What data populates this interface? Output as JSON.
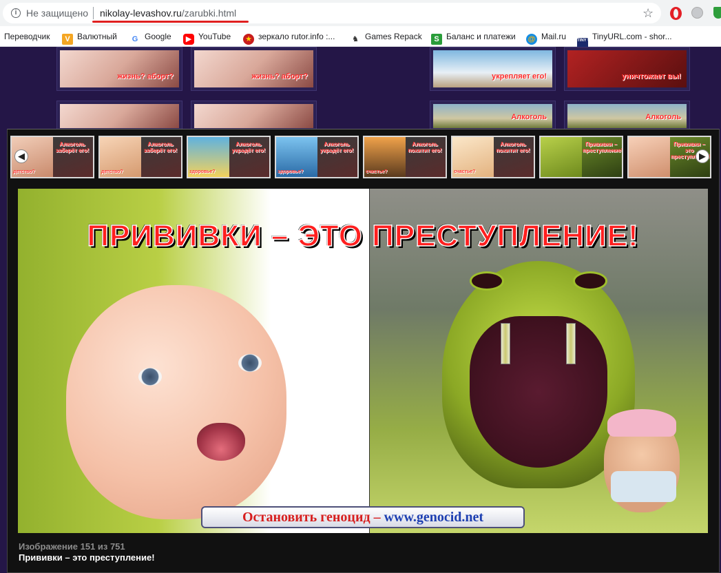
{
  "browser": {
    "security_label": "Не защищено",
    "url_domain": "nikolay-levashov.ru",
    "url_path": "/zarubki.html"
  },
  "bookmarks": [
    {
      "label": "Переводчик",
      "icon": "none"
    },
    {
      "label": "Валютный",
      "icon": "currency-icon"
    },
    {
      "label": "Google",
      "icon": "google-icon"
    },
    {
      "label": "YouTube",
      "icon": "youtube-icon"
    },
    {
      "label": "зеркало rutor.info :...",
      "icon": "rutor-icon"
    },
    {
      "label": "Games Repack",
      "icon": "repack-icon"
    },
    {
      "label": "Баланс и платежи",
      "icon": "skype-icon"
    },
    {
      "label": "Mail.ru",
      "icon": "mailru-icon"
    },
    {
      "label": "TinyURL.com - shor...",
      "icon": "tinyurl-icon"
    }
  ],
  "background_tiles": {
    "captions": [
      "жизнь? аборт?",
      "жизнь? аборт?",
      "укрепляет его!",
      "уничтожает вы!",
      "Алкоголь",
      "Алкоголь"
    ]
  },
  "lightbox": {
    "thumbnails": [
      {
        "left_caption": "детство?",
        "right_caption": "Алкоголь заберёт его!"
      },
      {
        "left_caption": "детство?",
        "right_caption": "Алкоголь заберёт его!"
      },
      {
        "left_caption": "здоровье?",
        "right_caption": "Алкоголь украдёт его!"
      },
      {
        "left_caption": "здоровье?",
        "right_caption": "Алкоголь украдёт его!"
      },
      {
        "left_caption": "счастье?",
        "right_caption": "Алкоголь похитит его!"
      },
      {
        "left_caption": "счастье?",
        "right_caption": "Алкоголь похитит его!"
      },
      {
        "left_caption": "",
        "right_caption": "Прививки – преступление!"
      },
      {
        "left_caption": "",
        "right_caption": "Прививки – это преступление!"
      }
    ],
    "main_image": {
      "headline": "ПРИВИВКИ – ЭТО ПРЕСТУПЛЕНИЕ!",
      "banner_red": "Остановить геноцид –",
      "banner_blue": "www.genocid.net"
    },
    "counter": "Изображение 151 из 751",
    "title": "Прививки – это преступление!"
  }
}
